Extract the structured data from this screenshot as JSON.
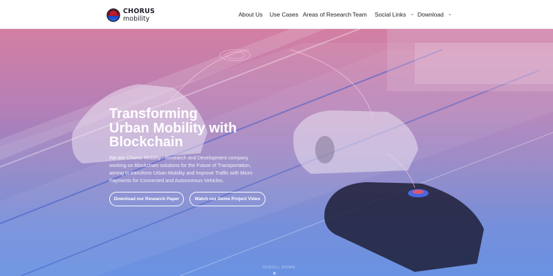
{
  "brand": {
    "name_top": "CHORUS",
    "name_bottom": "mobility",
    "logo_icon": "chorus-circle-logo-icon"
  },
  "nav": {
    "items": [
      {
        "label": "About Us"
      },
      {
        "label": "Use Cases"
      },
      {
        "label": "Areas of Research"
      },
      {
        "label": "Team"
      },
      {
        "label": "Social Links",
        "has_dropdown": true
      },
      {
        "label": "Download",
        "has_dropdown": true
      }
    ]
  },
  "hero": {
    "title_lines": [
      "Transforming",
      "Urban Mobility with",
      "Blockchain"
    ],
    "description": "We are Chorus Mobility - Research and Development company working on Blockchain solutions for the Future of Transportation, aiming to transform Urban Mobility and Improve Traffic with Micro Payments for Connected and Autonomous Vehicles.",
    "buttons": {
      "paper": "Download our Research Paper",
      "video": "Watch our Demo Project Video"
    },
    "scroll_hint": "SCROLL DOWN"
  },
  "colors": {
    "gradient_top": "#d47fa2",
    "gradient_bottom": "#5d89e0",
    "logo_red": "#e11d2b",
    "logo_blue": "#1c3fbf",
    "text_dark": "#222222"
  }
}
